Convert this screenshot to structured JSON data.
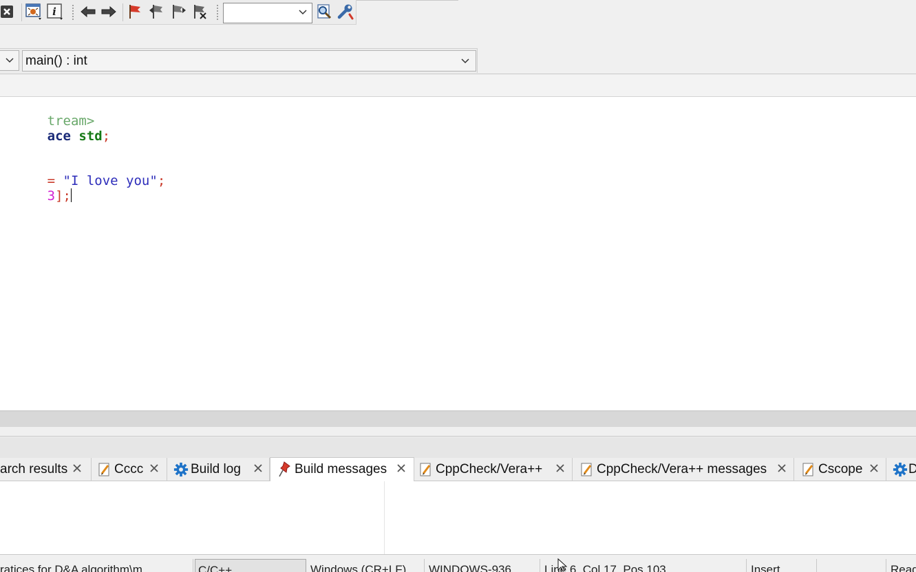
{
  "toolbar": {
    "search_combo_value": "",
    "buttons": [
      {
        "name": "abort-button",
        "icon": "close-icon"
      },
      {
        "name": "debug-window-button",
        "icon": "bug-window-icon"
      },
      {
        "name": "various-info-button",
        "icon": "info-icon"
      },
      {
        "name": "jump-back-button",
        "icon": "arrow-left-icon"
      },
      {
        "name": "jump-forward-button",
        "icon": "arrow-right-icon"
      },
      {
        "name": "toggle-bookmark-button",
        "icon": "flag-icon"
      },
      {
        "name": "prev-bookmark-button",
        "icon": "flag-prev-icon"
      },
      {
        "name": "next-bookmark-button",
        "icon": "flag-next-icon"
      },
      {
        "name": "clear-bookmarks-button",
        "icon": "flag-clear-icon"
      },
      {
        "name": "find-button",
        "icon": "magnifier-icon"
      },
      {
        "name": "options-button",
        "icon": "wrench-icon"
      }
    ]
  },
  "funcbar": {
    "scope_value": "",
    "function_value": "main() : int"
  },
  "editor": {
    "lines": [
      [
        {
          "t": "tream>",
          "c": "c-green"
        }
      ],
      [
        {
          "t": "ace",
          "c": "c-kw"
        },
        {
          "t": " ",
          "c": ""
        },
        {
          "t": "std",
          "c": "c-std"
        },
        {
          "t": ";",
          "c": "c-red"
        }
      ],
      [],
      [
        {
          "t": "= ",
          "c": "c-red"
        },
        {
          "t": "\"I love you\"",
          "c": "c-str"
        },
        {
          "t": ";",
          "c": "c-red"
        }
      ],
      [
        {
          "t": "3",
          "c": "c-num"
        },
        {
          "t": "];",
          "c": "c-red"
        }
      ]
    ]
  },
  "panel": {
    "tabs": [
      {
        "label": "arch results",
        "icon": "none"
      },
      {
        "label": "Cccc",
        "icon": "pencil-icon"
      },
      {
        "label": "Build log",
        "icon": "gear-icon"
      },
      {
        "label": "Build messages",
        "icon": "pin-icon"
      },
      {
        "label": "CppCheck/Vera++",
        "icon": "pencil-icon"
      },
      {
        "label": "CppCheck/Vera++ messages",
        "icon": "pencil-icon"
      },
      {
        "label": "Cscope",
        "icon": "pencil-icon"
      },
      {
        "label": "D",
        "icon": "gear-icon"
      }
    ]
  },
  "status": {
    "file": "ratices for D&A algorithm\\m",
    "language": "C/C++",
    "line_endings": "Windows (CR+LF)",
    "encoding": "WINDOWS-936",
    "position": "Line 6, Col 17, Pos 103",
    "mode": "Insert",
    "extra": "",
    "readonly": "Read"
  },
  "colors": {
    "accent_blue": "#1e73c8",
    "flag_red": "#d63a2a",
    "string_blue": "#2d2dba"
  }
}
